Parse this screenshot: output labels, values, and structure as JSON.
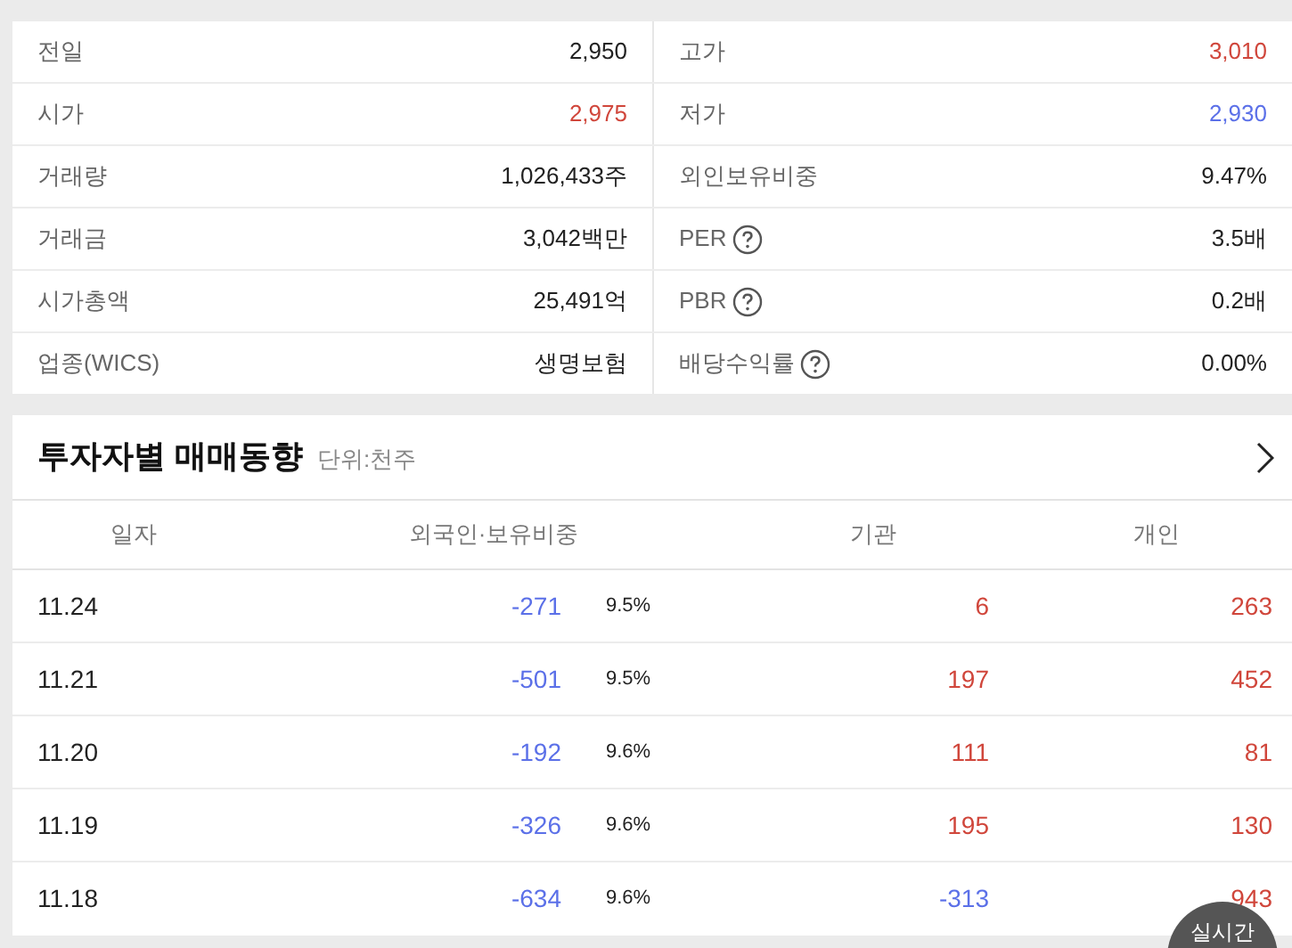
{
  "summary": {
    "rows": [
      {
        "left": {
          "label": "전일",
          "value": "2,950",
          "color": "#222222",
          "help": false
        },
        "right": {
          "label": "고가",
          "value": "3,010",
          "color": "#d0463b",
          "help": false
        }
      },
      {
        "left": {
          "label": "시가",
          "value": "2,975",
          "color": "#d0463b",
          "help": false
        },
        "right": {
          "label": "저가",
          "value": "2,930",
          "color": "#5b70e8",
          "help": false
        }
      },
      {
        "left": {
          "label": "거래량",
          "value": "1,026,433주",
          "color": "#222222",
          "help": false
        },
        "right": {
          "label": "외인보유비중",
          "value": "9.47%",
          "color": "#222222",
          "help": false
        }
      },
      {
        "left": {
          "label": "거래금",
          "value": "3,042백만",
          "color": "#222222",
          "help": false
        },
        "right": {
          "label": "PER",
          "value": "3.5배",
          "color": "#222222",
          "help": true
        }
      },
      {
        "left": {
          "label": "시가총액",
          "value": "25,491억",
          "color": "#222222",
          "help": false
        },
        "right": {
          "label": "PBR",
          "value": "0.2배",
          "color": "#222222",
          "help": true
        }
      },
      {
        "left": {
          "label": "업종(WICS)",
          "value": "생명보험",
          "color": "#222222",
          "help": false
        },
        "right": {
          "label": "배당수익률",
          "value": "0.00%",
          "color": "#222222",
          "help": true
        }
      }
    ]
  },
  "investors": {
    "title": "투자자별 매매동향",
    "unit": "단위:천주",
    "columns": [
      "일자",
      "외국인·보유비중",
      "기관",
      "개인"
    ],
    "rows": [
      {
        "date": "11.24",
        "foreign": {
          "value": "-271",
          "color": "#5b70e8"
        },
        "ratio": "9.5%",
        "institution": {
          "value": "6",
          "color": "#d0463b"
        },
        "individual": {
          "value": "263",
          "color": "#d0463b"
        }
      },
      {
        "date": "11.21",
        "foreign": {
          "value": "-501",
          "color": "#5b70e8"
        },
        "ratio": "9.5%",
        "institution": {
          "value": "197",
          "color": "#d0463b"
        },
        "individual": {
          "value": "452",
          "color": "#d0463b"
        }
      },
      {
        "date": "11.20",
        "foreign": {
          "value": "-192",
          "color": "#5b70e8"
        },
        "ratio": "9.6%",
        "institution": {
          "value": "111",
          "color": "#d0463b"
        },
        "individual": {
          "value": "81",
          "color": "#d0463b"
        }
      },
      {
        "date": "11.19",
        "foreign": {
          "value": "-326",
          "color": "#5b70e8"
        },
        "ratio": "9.6%",
        "institution": {
          "value": "195",
          "color": "#d0463b"
        },
        "individual": {
          "value": "130",
          "color": "#d0463b"
        }
      },
      {
        "date": "11.18",
        "foreign": {
          "value": "-634",
          "color": "#5b70e8"
        },
        "ratio": "9.6%",
        "institution": {
          "value": "-313",
          "color": "#5b70e8"
        },
        "individual": {
          "value": "943",
          "color": "#d0463b"
        }
      }
    ]
  },
  "realtime_button": "실시간"
}
